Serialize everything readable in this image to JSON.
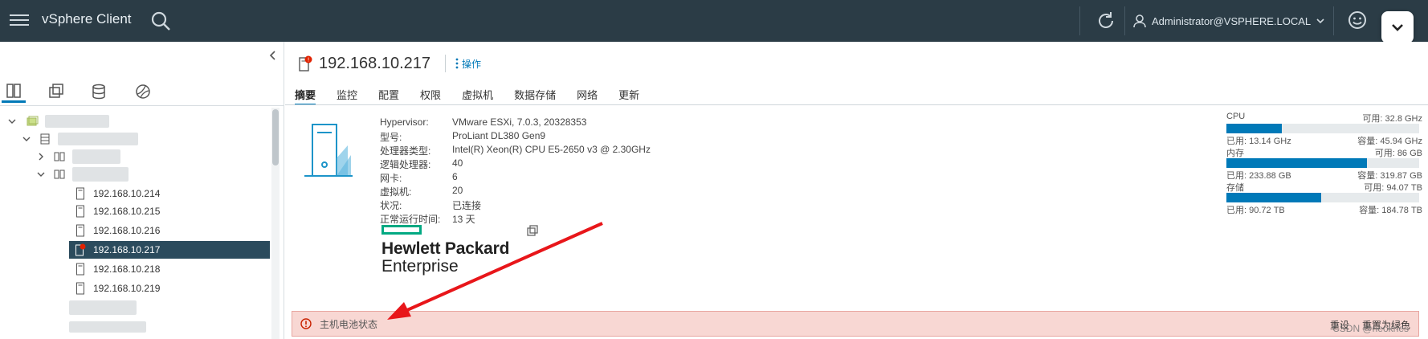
{
  "header": {
    "app_name": "vSphere Client",
    "user_label": "Administrator@VSPHERE.LOCAL",
    "colors": {
      "bg": "#2b3c46",
      "accent": "#0079b8"
    }
  },
  "navigator": {
    "tabs": [
      {
        "icon": "hosts-clusters-icon"
      },
      {
        "icon": "vms-templates-icon"
      },
      {
        "icon": "storage-icon"
      },
      {
        "icon": "networking-icon"
      }
    ],
    "hosts": [
      "192.168.10.214",
      "192.168.10.215",
      "192.168.10.216",
      "192.168.10.217",
      "192.168.10.218",
      "192.168.10.219"
    ],
    "selected_host": "192.168.10.217"
  },
  "host": {
    "name": "192.168.10.217",
    "actions_label": "操作",
    "tabs": [
      "摘要",
      "监控",
      "配置",
      "权限",
      "虚拟机",
      "数据存储",
      "网络",
      "更新"
    ],
    "active_tab": "摘要"
  },
  "summary": {
    "rows": [
      {
        "key": "Hypervisor:",
        "value": "VMware ESXi, 7.0.3, 20328353"
      },
      {
        "key": "型号:",
        "value": "ProLiant DL380 Gen9"
      },
      {
        "key": "处理器类型:",
        "value": "Intel(R) Xeon(R) CPU E5-2650 v3 @ 2.30GHz"
      },
      {
        "key": "逻辑处理器:",
        "value": "40"
      },
      {
        "key": "网卡:",
        "value": "6"
      },
      {
        "key": "虚拟机:",
        "value": "20"
      },
      {
        "key": "状况:",
        "value": "已连接"
      },
      {
        "key": "正常运行时间:",
        "value": "13 天"
      }
    ],
    "vendor_logo_line1": "Hewlett Packard",
    "vendor_logo_line2": "Enterprise"
  },
  "resources": [
    {
      "label": "CPU",
      "free": "可用: 32.8 GHz",
      "used": "已用: 13.14 GHz",
      "capacity": "容量: 45.94 GHz",
      "fraction": 0.286
    },
    {
      "label": "内存",
      "free": "可用: 86 GB",
      "used": "已用: 233.88 GB",
      "capacity": "容量: 319.87 GB",
      "fraction": 0.731
    },
    {
      "label": "存储",
      "free": "可用: 94.07 TB",
      "used": "已用: 90.72 TB",
      "capacity": "容量: 184.78 TB",
      "fraction": 0.491
    }
  ],
  "alert": {
    "message": "主机电池状态",
    "reset_label": "重设",
    "green_label": "重置为绿色"
  },
  "watermark": "CSDN @rieoknes"
}
